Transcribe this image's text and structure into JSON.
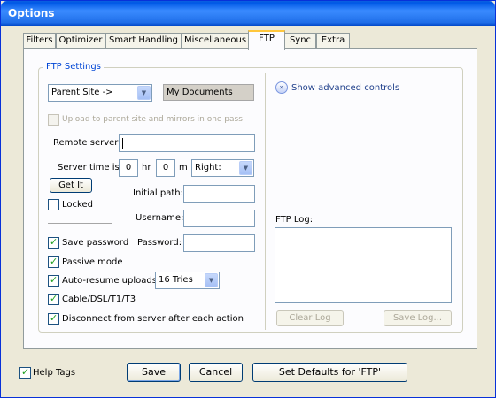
{
  "window": {
    "title": "Options"
  },
  "tabs": [
    "Filters",
    "Optimizer",
    "Smart Handling",
    "Miscellaneous",
    "FTP",
    "Sync",
    "Extra"
  ],
  "active_tab": "FTP",
  "ftp_settings": {
    "group_title": "FTP Settings",
    "site_select": "Parent Site  ->",
    "folder_display": "My Documents",
    "upload_checkbox": "Upload to parent site and mirrors in one pass",
    "remote_server_label": "Remote server:",
    "remote_server_value": "",
    "server_time_label": "Server time is:",
    "hours_value": "0",
    "hours_unit": "hr",
    "minutes_value": "0",
    "minutes_unit": "m",
    "direction_select": "Right:",
    "get_it_button": "Get It",
    "locked_label": "Locked",
    "initial_path_label": "Initial path:",
    "username_label": "Username:",
    "password_label": "Password:",
    "save_password_label": "Save password",
    "passive_mode_label": "Passive mode",
    "auto_resume_label": "Auto-resume uploads:",
    "tries_select": "16 Tries",
    "cable_label": "Cable/DSL/T1/T3",
    "disconnect_label": "Disconnect from server after each action",
    "advanced_link": "Show advanced controls",
    "ftp_log_label": "FTP Log:",
    "clear_log_button": "Clear Log",
    "save_log_button": "Save Log..."
  },
  "footer": {
    "help_tags_label": "Help Tags",
    "save_button": "Save",
    "cancel_button": "Cancel",
    "defaults_button": "Set Defaults for 'FTP'"
  }
}
